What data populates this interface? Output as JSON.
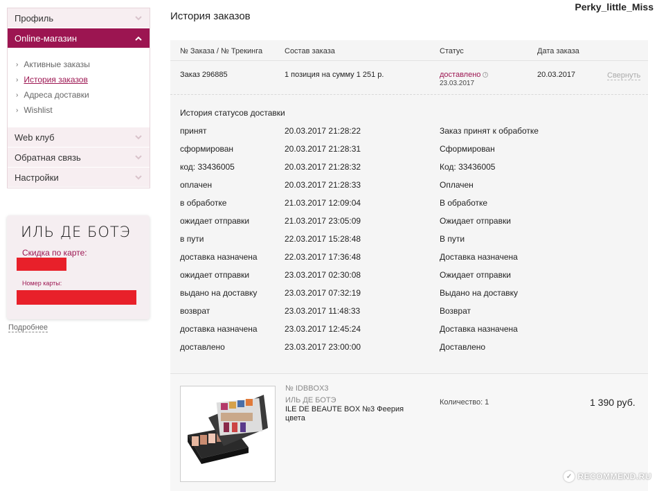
{
  "user": {
    "name": "Perky_little_Miss"
  },
  "page": {
    "title": "История заказов"
  },
  "sidebar": {
    "items": [
      {
        "label": "Профиль"
      },
      {
        "label": "Online-магазин"
      },
      {
        "label": "Web клуб"
      },
      {
        "label": "Обратная связь"
      },
      {
        "label": "Настройки"
      }
    ],
    "submenu": [
      {
        "label": "Активные заказы"
      },
      {
        "label": "История заказов"
      },
      {
        "label": "Адреса доставки"
      },
      {
        "label": "Wishlist"
      }
    ]
  },
  "card": {
    "brand": "ИЛЬ ДЕ БОТЭ",
    "discount_label": "Скидка по карте:",
    "number_label": "Номер карты:",
    "more_link": "Подробнее"
  },
  "table": {
    "headers": [
      "№ Заказа / № Трекинга",
      "Состав заказа",
      "Статус",
      "Дата заказа"
    ],
    "order": {
      "number": "Заказ 296885",
      "contents": "1 позиция на сумму 1 251 р.",
      "status": "доставлено",
      "status_date": "23.03.2017",
      "order_date": "20.03.2017",
      "collapse": "Свернуть"
    }
  },
  "history": {
    "title": "История статусов доставки",
    "rows": [
      {
        "code": "принят",
        "datetime": "20.03.2017 21:28:22",
        "desc": "Заказ принят к обработке"
      },
      {
        "code": "сформирован",
        "datetime": "20.03.2017 21:28:31",
        "desc": "Сформирован"
      },
      {
        "code": "код: 33436005",
        "datetime": "20.03.2017 21:28:32",
        "desc": "Код: 33436005"
      },
      {
        "code": "оплачен",
        "datetime": "20.03.2017 21:28:33",
        "desc": "Оплачен"
      },
      {
        "code": "в обработке",
        "datetime": "21.03.2017 12:09:04",
        "desc": "В обработке"
      },
      {
        "code": "ожидает отправки",
        "datetime": "21.03.2017 23:05:09",
        "desc": "Ожидает отправки"
      },
      {
        "code": "в пути",
        "datetime": "22.03.2017 15:28:48",
        "desc": "В пути"
      },
      {
        "code": "доставка назначена",
        "datetime": "22.03.2017 17:36:48",
        "desc": "Доставка назначена"
      },
      {
        "code": "ожидает отправки",
        "datetime": "23.03.2017 02:30:08",
        "desc": "Ожидает отправки"
      },
      {
        "code": "выдано на доставку",
        "datetime": "23.03.2017 07:32:19",
        "desc": "Выдано на доставку"
      },
      {
        "code": "возврат",
        "datetime": "23.03.2017 11:48:33",
        "desc": "Возврат"
      },
      {
        "code": "доставка назначена",
        "datetime": "23.03.2017 12:45:24",
        "desc": "Доставка назначена"
      },
      {
        "code": "доставлено",
        "datetime": "23.03.2017 23:00:00",
        "desc": "Доставлено"
      }
    ]
  },
  "product": {
    "sku": "№ IDBBOX3",
    "brand": "ИЛЬ ДЕ БОТЭ",
    "name": "ILE DE BEAUTE BOX №3 Феерия цвета",
    "quantity": "Количество: 1",
    "price": "1 390 руб."
  },
  "watermark": {
    "text": "RECOMMEND.RU"
  }
}
